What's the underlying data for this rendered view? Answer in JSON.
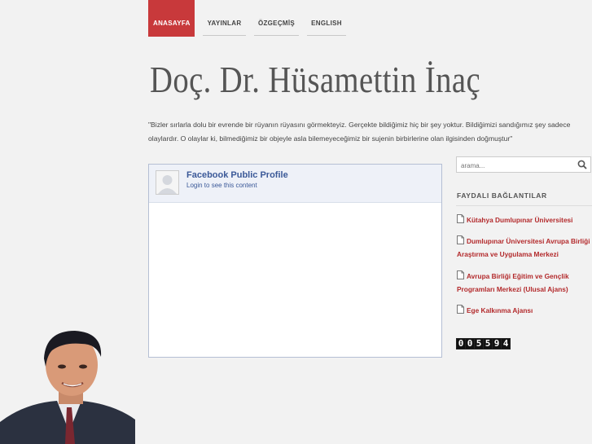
{
  "nav": {
    "items": [
      "ANASAYFA",
      "YAYINLAR",
      "ÖZGEÇMİŞ",
      "ENGLISH"
    ]
  },
  "header": {
    "title": "Doç. Dr. Hüsamettin İnaç"
  },
  "quote": "\"Bizler sırlarla dolu bir evrende bir rüyanın rüyasını görmekteyiz. Gerçekte bildiğimiz hiç bir şey yoktur. Bildiğimizi sandığımız şey sadece olaylardır. O olaylar ki, bilmediğimiz bir objeyle asla bilemeyeceğimiz bir sujenin birbirlerine olan ilgisinden doğmuştur\"",
  "facebook": {
    "name": "Facebook Public Profile",
    "login": "Login to see this content"
  },
  "search": {
    "placeholder": "arama..."
  },
  "sidebar": {
    "heading": "FAYDALI BAĞLANTILAR",
    "links": [
      "Kütahya Dumlupınar Üniversitesi",
      "Dumlupınar Üniversitesi Avrupa Birliği Araştırma ve Uygulama Merkezi",
      "Avrupa Birliği Eğitim ve Gençlik Programları Merkezi (Ulusal Ajans)",
      "Ege Kalkınma Ajansı"
    ]
  },
  "counter": {
    "digits": [
      "0",
      "0",
      "5",
      "5",
      "9",
      "4"
    ]
  },
  "colors": {
    "accent": "#c8393b",
    "link": "#b32a2c",
    "facebook": "#3b5998"
  },
  "icons": [
    "search-icon",
    "page-icon",
    "avatar-silhouette-icon"
  ]
}
